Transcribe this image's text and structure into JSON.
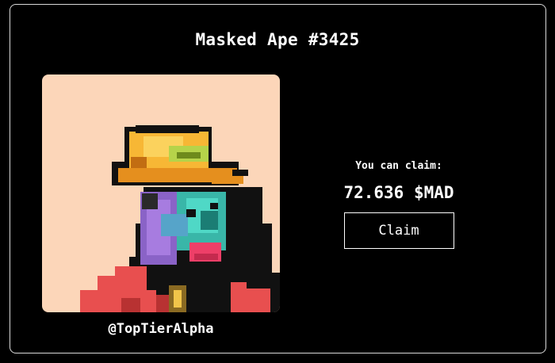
{
  "nft": {
    "title": "Masked Ape #3425",
    "owner_handle": "@TopTierAlpha",
    "image_icon": "masked-ape-pixel-avatar",
    "image_background": "#fcd6b9"
  },
  "claim": {
    "label": "You can claim:",
    "amount": "72.636 $MAD",
    "button_label": "Claim"
  }
}
